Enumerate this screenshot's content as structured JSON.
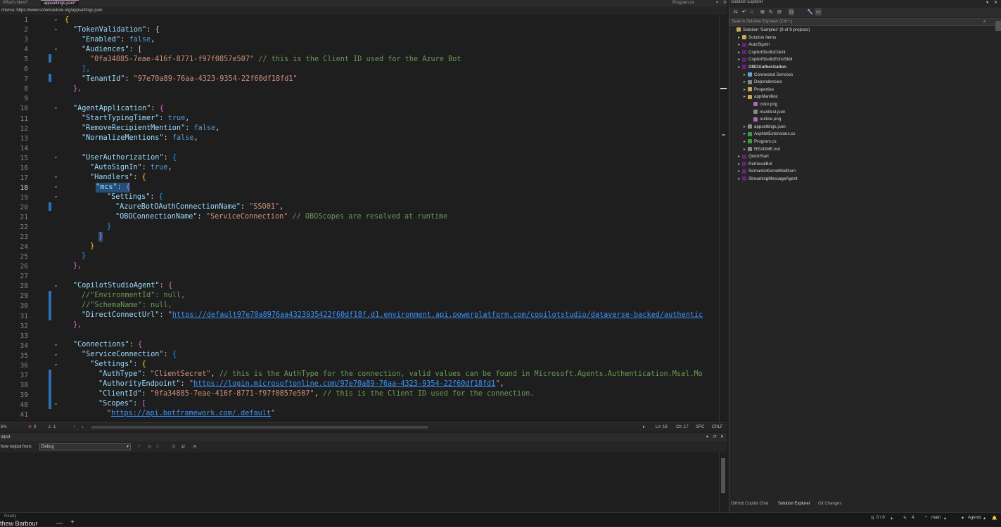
{
  "tabs": {
    "whats_new": "What's New?",
    "appsettings": "appsettings.json*",
    "program": "Program.cs"
  },
  "schema": {
    "label": "chema:",
    "url": "https://www.schemastore.org/appsettings.json"
  },
  "editor": {
    "current_line": 18,
    "lines": [
      "1",
      "2",
      "3",
      "4",
      "5",
      "6",
      "7",
      "8",
      "9",
      "10",
      "11",
      "12",
      "13",
      "14",
      "15",
      "16",
      "17",
      "18",
      "19",
      "20",
      "21",
      "22",
      "23",
      "24",
      "25",
      "26",
      "27",
      "28",
      "29",
      "30",
      "31",
      "32",
      "33",
      "34",
      "35",
      "36",
      "37",
      "38",
      "39",
      "40",
      "41"
    ]
  },
  "code": {
    "l1": "{",
    "l2_key": "\"TokenValidation\"",
    "l2_rest": ": {",
    "l3_key": "\"Enabled\"",
    "l3_val": "false",
    "l4_key": "\"Audiences\"",
    "l4_rest": ": [",
    "l5_str": "\"0fa34885-7eae-416f-8771-f97f0857e507\"",
    "l5_comment": "// this is the Client ID used for the Azure Bot",
    "l6": "],",
    "l7_key": "\"TenantId\"",
    "l7_val": "\"97e70a89-76aa-4323-9354-22f60df18fd1\"",
    "l8": "},",
    "l10_key": "\"AgentApplication\"",
    "l11_key": "\"StartTypingTimer\"",
    "l11_val": "true",
    "l12_key": "\"RemoveRecipientMention\"",
    "l12_val": "false",
    "l13_key": "\"NormalizeMentions\"",
    "l13_val": "false",
    "l15_key": "\"UserAuthorization\"",
    "l16_key": "\"AutoSignIn\"",
    "l16_val": "true",
    "l17_key": "\"Handlers\"",
    "l18_key": "\"mcs\"",
    "l19_key": "\"Settings\"",
    "l20_key": "\"AzureBotOAuthConnectionName\"",
    "l20_val": "\"SSO01\"",
    "l21_key": "\"OBOConnectionName\"",
    "l21_val": "\"ServiceConnection\"",
    "l21_comment": "// OBOScopes are resolved at runtime",
    "l28_key": "\"CopilotStudioAgent\"",
    "l29_comment": "//\"EnvironmentId\": null,",
    "l30_comment": "//\"SchemaName\": null,",
    "l31_key": "\"DirectConnectUrl\"",
    "l31_url": "https://default97e70a8976aa4323935422f60df18f.d1.environment.api.powerplatform.com/copilotstudio/dataverse-backed/authentic",
    "l34_key": "\"Connections\"",
    "l35_key": "\"ServiceConnection\"",
    "l36_key": "\"Settings\"",
    "l37_key": "\"AuthType\"",
    "l37_val": "\"ClientSecret\"",
    "l37_comment": "// this is the AuthType for the connection, valid values can be found in Microsoft.Agents.Authentication.Msal.Mo",
    "l38_key": "\"AuthorityEndpoint\"",
    "l38_url": "https://login.microsoftonline.com/97e70a89-76aa-4323-9354-22f60df18fd1",
    "l39_key": "\"ClientId\"",
    "l39_val": "\"0fa34885-7eae-416f-8771-f97f0857e507\"",
    "l39_comment": "// this is the Client ID used for the connection.",
    "l40_key": "\"Scopes\"",
    "l41_url": "https://api.botframework.com/.default"
  },
  "status": {
    "zoom": "6%",
    "errors": "0",
    "warnings": "1",
    "ln": "Ln: 18",
    "ch": "Ch: 17",
    "spc": "SPC",
    "crlf": "CRLF"
  },
  "output": {
    "title": "utput",
    "show_from_label": "how output from:",
    "source": "Debug"
  },
  "solution": {
    "title": "Solution Explorer",
    "search_placeholder": "Search Solution Explorer (Ctrl+;)",
    "items": [
      {
        "label": "Solution 'Samples' (8 of 8 projects)",
        "indent": 0,
        "bold": false
      },
      {
        "label": "Solution Items",
        "indent": 1,
        "bold": false
      },
      {
        "label": "AutoSignIn",
        "indent": 1,
        "bold": false
      },
      {
        "label": "CopilotStudioClient",
        "indent": 1,
        "bold": false
      },
      {
        "label": "CopilotStudioEchoSkill",
        "indent": 1,
        "bold": false
      },
      {
        "label": "OBOAuthorization",
        "indent": 1,
        "bold": true
      },
      {
        "label": "Connected Services",
        "indent": 2,
        "bold": false
      },
      {
        "label": "Dependencies",
        "indent": 2,
        "bold": false
      },
      {
        "label": "Properties",
        "indent": 2,
        "bold": false
      },
      {
        "label": "appManifest",
        "indent": 2,
        "bold": false
      },
      {
        "label": "color.png",
        "indent": 3,
        "bold": false
      },
      {
        "label": "manifest.json",
        "indent": 3,
        "bold": false
      },
      {
        "label": "outline.png",
        "indent": 3,
        "bold": false
      },
      {
        "label": "appsettings.json",
        "indent": 2,
        "bold": false
      },
      {
        "label": "AspNetExtensions.cs",
        "indent": 2,
        "bold": false
      },
      {
        "label": "Program.cs",
        "indent": 2,
        "bold": false
      },
      {
        "label": "README.md",
        "indent": 2,
        "bold": false
      },
      {
        "label": "QuickStart",
        "indent": 1,
        "bold": false
      },
      {
        "label": "RetrievalBot",
        "indent": 1,
        "bold": false
      },
      {
        "label": "SemanticKernelMultiturn",
        "indent": 1,
        "bold": false
      },
      {
        "label": "StreamingMessageAgent",
        "indent": 1,
        "bold": false
      }
    ],
    "bottom_tabs": [
      "GitHub Copilot Chat",
      "Solution Explorer",
      "Git Changes"
    ]
  },
  "bottom": {
    "ready": "Ready",
    "user": "thew Barbour",
    "git_count": "0 / 0",
    "pencil": "4",
    "branch": "main",
    "agents": "Agents"
  },
  "colors": {
    "background": "#1e1e1e",
    "key": "#9cdcfe",
    "string": "#ce9178",
    "comment": "#6a9955",
    "keyword": "#569cd6",
    "link": "#3794ff"
  }
}
